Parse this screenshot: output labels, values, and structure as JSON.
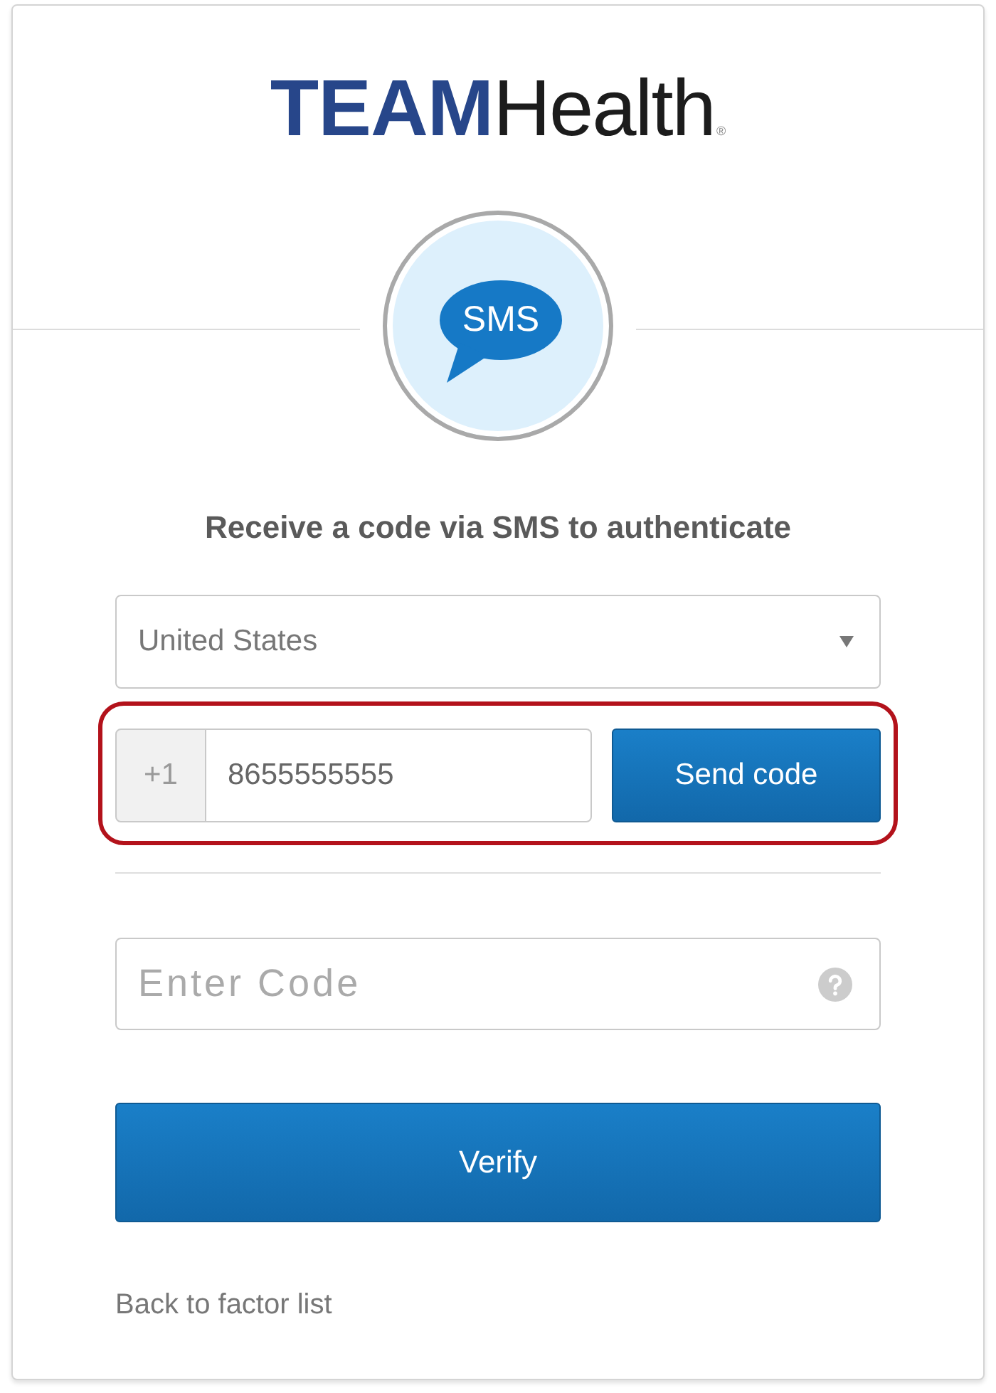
{
  "logo": {
    "bold_part": "TEAM",
    "regular_part": "Health",
    "mark": "®"
  },
  "factor_badge": {
    "label": "SMS"
  },
  "title": "Receive a code via SMS to authenticate",
  "country_select": {
    "value": "United States"
  },
  "phone": {
    "prefix": "+1",
    "value": "8655555555",
    "highlighted": true
  },
  "send_button": "Send code",
  "code_field": {
    "placeholder": "Enter Code"
  },
  "verify_button": "Verify",
  "back_link": "Back to factor list"
}
